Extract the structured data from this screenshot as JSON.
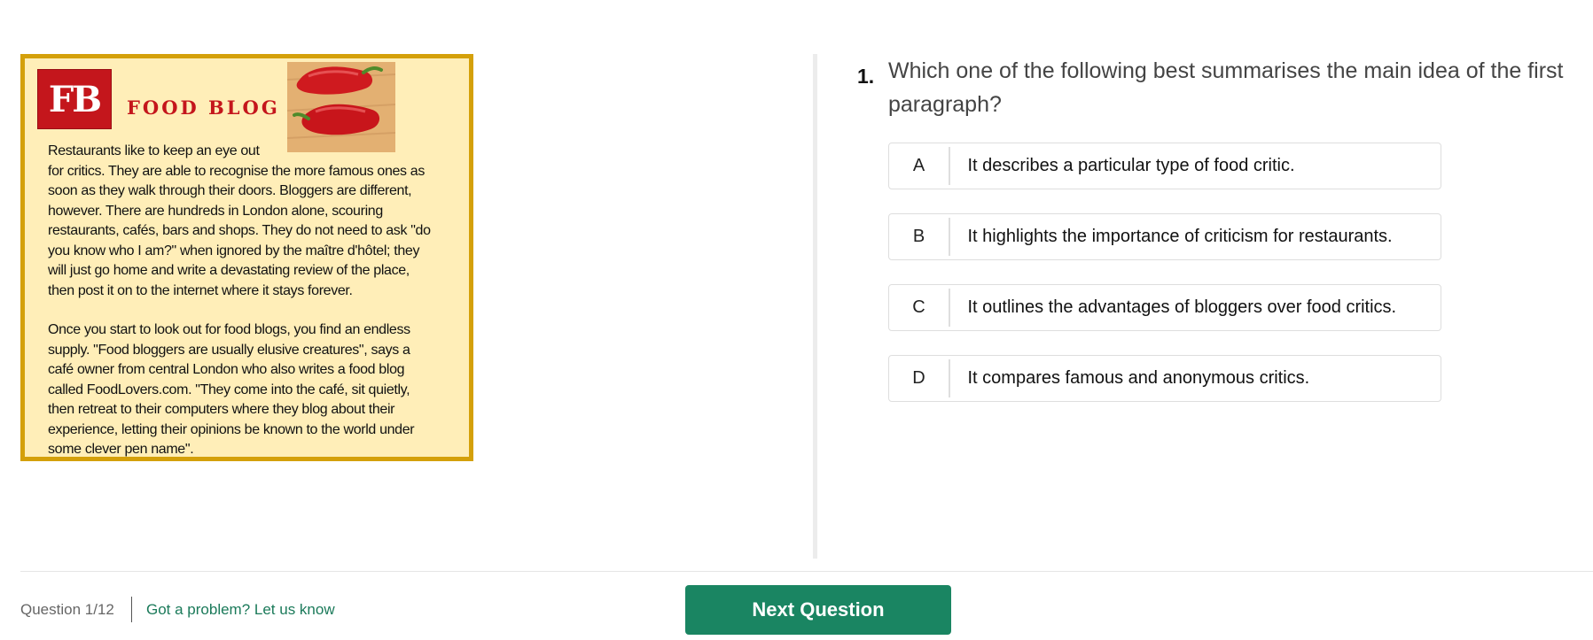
{
  "passage": {
    "logo_text": "FB",
    "blog_title": "FOOD BLOG",
    "paragraphs": [
      "Restaurants like to keep an eye out\nfor critics. They are able to recognise the more famous ones as\nsoon as they walk through their doors. Bloggers are different,\nhowever. There are hundreds in London alone, scouring\nrestaurants, cafés, bars and shops. They do not need to ask \"do\nyou know who I am?\" when ignored by the maître d'hôtel; they\nwill just go home and write a devastating review of the place,\nthen post it on to the internet where it stays forever.",
      "Once you start to look out for food blogs, you find an endless\nsupply. \"Food bloggers are usually elusive creatures\", says a\ncafé owner from central London who also writes a food blog\ncalled FoodLovers.com. \"They come into the café, sit quietly,\nthen retreat to their computers where they blog about their\nexperience, letting their opinions be known to the world under\nsome clever pen name\"."
    ]
  },
  "question": {
    "number": "1.",
    "text": "Which one of the following best summarises the main idea of the first paragraph?",
    "options": [
      {
        "letter": "A",
        "text": "It describes a particular type of food critic."
      },
      {
        "letter": "B",
        "text": "It highlights the importance of criticism for restaurants."
      },
      {
        "letter": "C",
        "text": "It outlines the advantages of bloggers over food critics."
      },
      {
        "letter": "D",
        "text": "It compares famous and anonymous critics."
      }
    ]
  },
  "footer": {
    "counter": "Question 1/12",
    "report_link": "Got a problem? Let us know",
    "next_button": "Next Question"
  },
  "colors": {
    "passage_bg": "#ffeeb8",
    "passage_border": "#d4a00a",
    "brand_red": "#c4161c",
    "accent_green": "#1a8562",
    "link_green": "#1b7a5a"
  }
}
